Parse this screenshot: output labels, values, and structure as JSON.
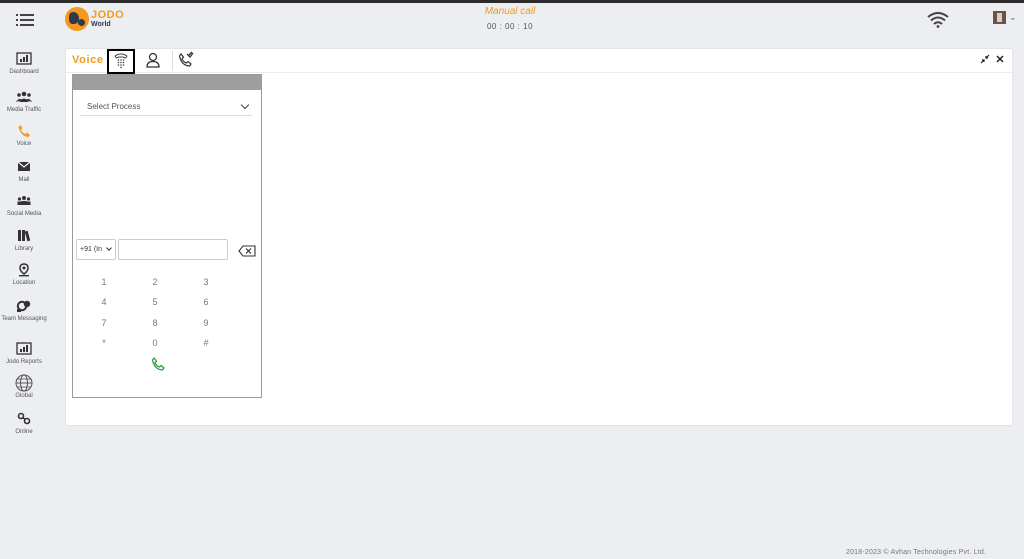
{
  "header": {
    "brand_name": "JODO",
    "brand_sub": "World",
    "call_mode": "Manual call",
    "call_timer": "00 : 00 : 10"
  },
  "sidebar": {
    "items": [
      {
        "label": "Dashboard",
        "icon": "dashboard-icon"
      },
      {
        "label": "Media Traffic",
        "icon": "media-traffic-icon"
      },
      {
        "label": "Voice",
        "icon": "phone-icon",
        "active": true
      },
      {
        "label": "Mail",
        "icon": "mail-icon"
      },
      {
        "label": "Social Media",
        "icon": "social-media-icon"
      },
      {
        "label": "Library",
        "icon": "library-icon"
      },
      {
        "label": "Location",
        "icon": "location-icon"
      },
      {
        "label": "Team Messaging",
        "icon": "team-messaging-icon"
      },
      {
        "label": "Jodo Reports",
        "icon": "reports-icon"
      },
      {
        "label": "Global",
        "icon": "globe-icon"
      },
      {
        "label": "Online",
        "icon": "online-icon"
      }
    ]
  },
  "panel": {
    "title": "Voice",
    "tabs": [
      {
        "icon": "dialpad-icon",
        "selected": true
      },
      {
        "icon": "contact-icon",
        "selected": false
      },
      {
        "icon": "call-history-icon",
        "selected": false
      }
    ]
  },
  "dialer": {
    "process_placeholder": "Select Process",
    "country_code": "+91 (In",
    "phone_value": "",
    "keys": [
      "1",
      "2",
      "3",
      "4",
      "5",
      "6",
      "7",
      "8",
      "9",
      "*",
      "0",
      "#"
    ]
  },
  "footer": {
    "copyright": "2018-2023 © Avhan Technologies Pvt. Ltd."
  },
  "colors": {
    "accent": "#f39a1e",
    "call_green": "#2e9e3a"
  }
}
